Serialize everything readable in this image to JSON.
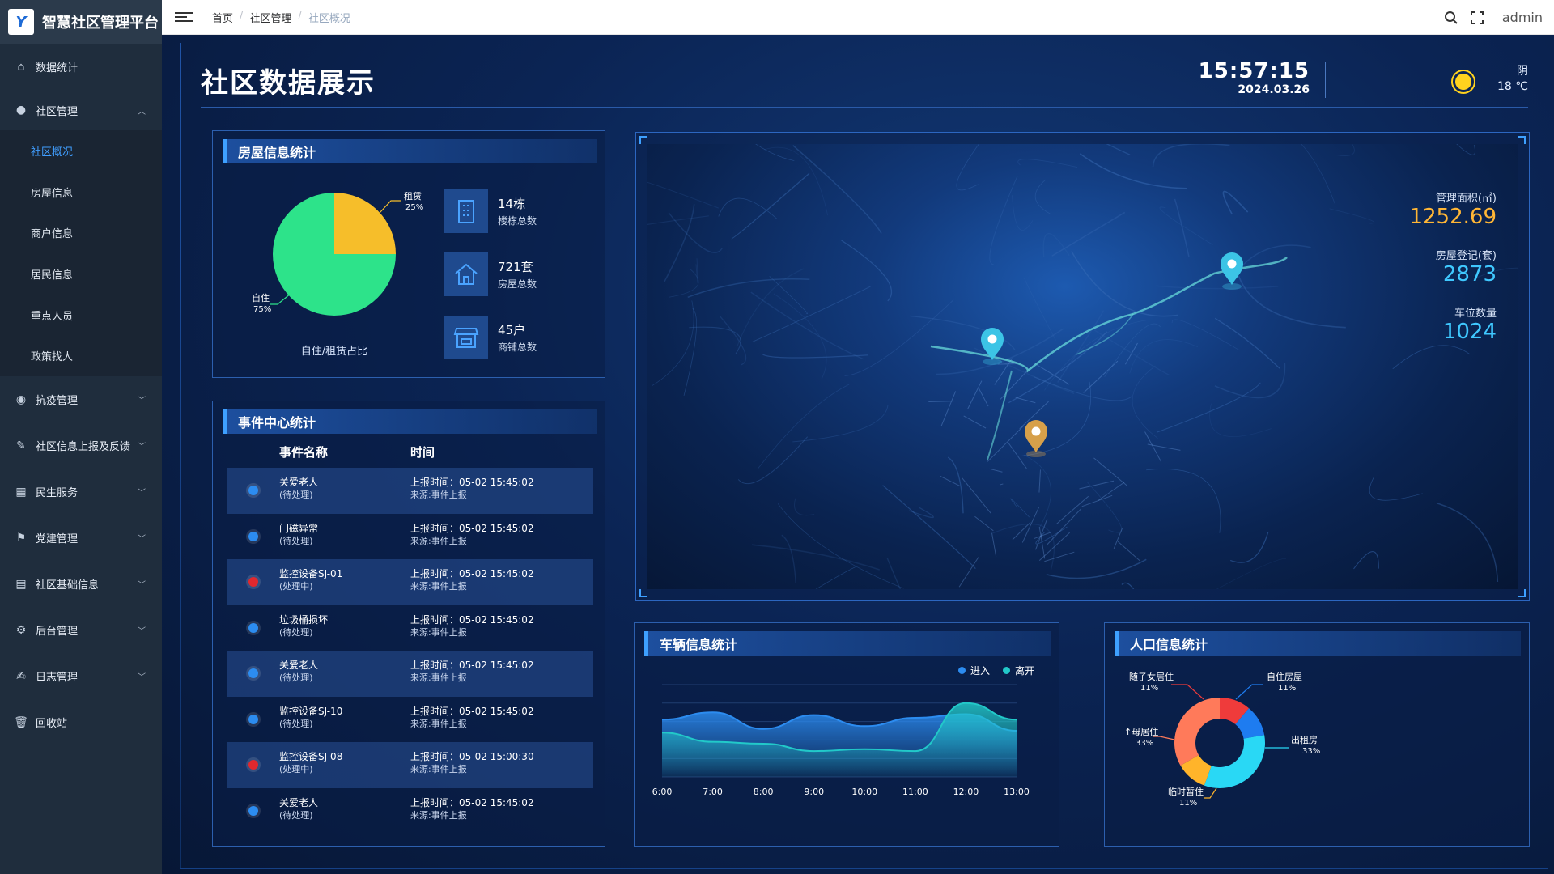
{
  "app": {
    "title": "智慧社区管理平台",
    "logo_glyph": "Y"
  },
  "sidebar": {
    "items": [
      {
        "icon": "home-icon",
        "glyph": "⌂",
        "label": "数据统计"
      },
      {
        "icon": "user-icon",
        "glyph": "●",
        "label": "社区管理",
        "open": true,
        "children": [
          "社区概况",
          "房屋信息",
          "商户信息",
          "居民信息",
          "重点人员",
          "政策找人"
        ]
      },
      {
        "icon": "bulb-icon",
        "glyph": "◉",
        "label": "抗疫管理"
      },
      {
        "icon": "paperclip-icon",
        "glyph": "✎",
        "label": "社区信息上报及反馈"
      },
      {
        "icon": "service-icon",
        "glyph": "▦",
        "label": "民生服务"
      },
      {
        "icon": "flag-icon",
        "glyph": "⚑",
        "label": "党建管理"
      },
      {
        "icon": "document-icon",
        "glyph": "▤",
        "label": "社区基础信息"
      },
      {
        "icon": "gear-icon",
        "glyph": "⚙",
        "label": "后台管理"
      },
      {
        "icon": "log-icon",
        "glyph": "✍",
        "label": "日志管理"
      },
      {
        "icon": "trash-icon",
        "glyph": "🗑",
        "label": "回收站"
      }
    ],
    "active_child": "社区概况"
  },
  "header": {
    "breadcrumb": [
      "首页",
      "社区管理",
      "社区概况"
    ],
    "user": "admin"
  },
  "dashboard": {
    "title": "社区数据展示",
    "time": "15:57:15",
    "date": "2024.03.26",
    "weather": {
      "condition": "阴",
      "temp": "18 ℃"
    },
    "house": {
      "title": "房屋信息统计",
      "pie_caption": "自住/租赁占比",
      "stats": [
        {
          "icon": "building-icon",
          "value": "14栋",
          "label": "楼栋总数"
        },
        {
          "icon": "house-icon",
          "value": "721套",
          "label": "房屋总数"
        },
        {
          "icon": "shop-icon",
          "value": "45户",
          "label": "商铺总数"
        }
      ]
    },
    "events": {
      "title": "事件中心统计",
      "col_name": "事件名称",
      "col_time": "时间",
      "rows": [
        {
          "name": "关爱老人",
          "status": "(待处理)",
          "time": "上报时间：05-02 15:45:02",
          "source": "来源:事件上报",
          "color": "#2c8cf0"
        },
        {
          "name": "门磁异常",
          "status": "(待处理)",
          "time": "上报时间：05-02 15:45:02",
          "source": "来源:事件上报",
          "color": "#2c8cf0"
        },
        {
          "name": "监控设备SJ-01",
          "status": "(处理中)",
          "time": "上报时间：05-02 15:45:02",
          "source": "来源:事件上报",
          "color": "#e0282e"
        },
        {
          "name": "垃圾桶损坏",
          "status": "(待处理)",
          "time": "上报时间：05-02 15:45:02",
          "source": "来源:事件上报",
          "color": "#2c8cf0"
        },
        {
          "name": "关爱老人",
          "status": "(待处理)",
          "time": "上报时间：05-02 15:45:02",
          "source": "来源:事件上报",
          "color": "#2c8cf0"
        },
        {
          "name": "监控设备SJ-10",
          "status": "(待处理)",
          "time": "上报时间：05-02 15:45:02",
          "source": "来源:事件上报",
          "color": "#2c8cf0"
        },
        {
          "name": "监控设备SJ-08",
          "status": "(处理中)",
          "time": "上报时间：05-02 15:00:30",
          "source": "来源:事件上报",
          "color": "#e0282e"
        },
        {
          "name": "关爱老人",
          "status": "(待处理)",
          "time": "上报时间：05-02 15:45:02",
          "source": "来源:事件上报",
          "color": "#2c8cf0"
        }
      ]
    },
    "map": {
      "stats": [
        {
          "label": "管理面积(㎡)",
          "value": "1252.69",
          "color": "#ffb636"
        },
        {
          "label": "房屋登记(套)",
          "value": "2873",
          "color": "#3fc8ff"
        },
        {
          "label": "车位数量",
          "value": "1024",
          "color": "#3fc8ff"
        }
      ],
      "pins": [
        {
          "name": "pin-1",
          "color": "#3cc4e6"
        },
        {
          "name": "pin-2",
          "color": "#3cc4e6"
        },
        {
          "name": "pin-3",
          "color": "#d7a04a"
        }
      ]
    },
    "vehicle": {
      "title": "车辆信息统计"
    },
    "population": {
      "title": "人口信息统计"
    }
  },
  "chart_data": [
    {
      "type": "pie",
      "title": "自住/租赁占比",
      "categories": [
        "租赁",
        "自住"
      ],
      "values": [
        25,
        75
      ],
      "labels": [
        "25%",
        "75%"
      ],
      "colors": [
        "#f6be2a",
        "#2de38a"
      ]
    },
    {
      "type": "area",
      "categories": [
        "6:00",
        "7:00",
        "8:00",
        "9:00",
        "10:00",
        "11:00",
        "12:00",
        "13:00"
      ],
      "series": [
        {
          "name": "进入",
          "color": "#2c8cf0",
          "values": [
            62,
            70,
            52,
            67,
            55,
            64,
            68,
            50
          ]
        },
        {
          "name": "离开",
          "color": "#22c9c9",
          "values": [
            48,
            38,
            36,
            28,
            30,
            28,
            80,
            62
          ]
        }
      ],
      "ylim": [
        0,
        100
      ],
      "legend": "top-right"
    },
    {
      "type": "pie",
      "donut": true,
      "categories": [
        "随子女居住",
        "自住房屋",
        "出租房",
        "临时暂住",
        "与父母居住"
      ],
      "labels_text": [
        "随子女居住",
        "自住房屋",
        "出租房",
        "临时暂住",
        "↑母居住"
      ],
      "values": [
        11,
        11,
        33,
        11,
        33
      ],
      "labels": [
        "11%",
        "11%",
        "33%",
        "11%",
        "33%"
      ],
      "colors": [
        "#ef3b3b",
        "#1e7cf0",
        "#29d8f5",
        "#ffb42a",
        "#ff7a5a"
      ]
    }
  ]
}
